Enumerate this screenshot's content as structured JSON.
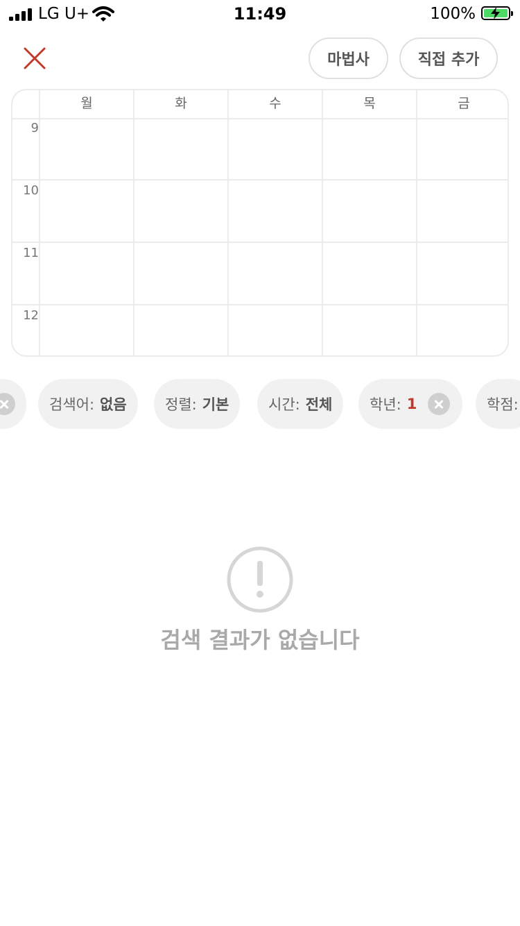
{
  "status_bar": {
    "carrier": "LG U+",
    "time": "11:49",
    "battery": "100%"
  },
  "header": {
    "wizard_label": "마법사",
    "direct_add_label": "직접 추가"
  },
  "timetable": {
    "days": [
      "월",
      "화",
      "수",
      "목",
      "금"
    ],
    "hours": [
      "9",
      "10",
      "11",
      "12"
    ]
  },
  "filters": [
    {
      "label": "검색어:",
      "value": "없음"
    },
    {
      "label": "정렬:",
      "value": "기본"
    },
    {
      "label": "시간:",
      "value": "전체"
    },
    {
      "label": "학년:",
      "value": "1"
    },
    {
      "label": "학점:",
      "value": ""
    }
  ],
  "empty_state": {
    "message": "검색 결과가 없습니다"
  },
  "colors": {
    "accent": "#c0392b",
    "battery": "#4cd964"
  }
}
